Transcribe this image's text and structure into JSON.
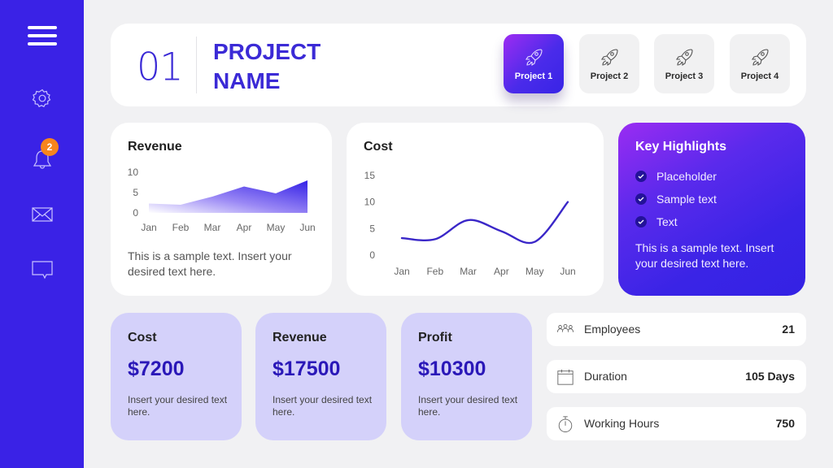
{
  "sidebar": {
    "items": [
      {
        "icon": "menu-icon"
      },
      {
        "icon": "gear-icon"
      },
      {
        "icon": "bell-icon",
        "badge": "2"
      },
      {
        "icon": "mail-icon"
      },
      {
        "icon": "chat-icon"
      }
    ],
    "notification_count": "2"
  },
  "header": {
    "project_number": "01",
    "project_name_line1": "PROJECT",
    "project_name_line2": "NAME",
    "tabs": [
      {
        "label": "Project 1",
        "icon": "rocket-icon",
        "active": true
      },
      {
        "label": "Project 2",
        "icon": "rocket-icon",
        "active": false
      },
      {
        "label": "Project 3",
        "icon": "rocket-icon",
        "active": false
      },
      {
        "label": "Project 4",
        "icon": "rocket-icon",
        "active": false
      }
    ]
  },
  "revenue_card": {
    "title": "Revenue",
    "description": "This is a sample text. Insert your desired text here."
  },
  "cost_card": {
    "title": "Cost"
  },
  "chart_data": [
    {
      "type": "area",
      "title": "Revenue",
      "categories": [
        "Jan",
        "Feb",
        "Mar",
        "Apr",
        "May",
        "Jun"
      ],
      "values": [
        2.3,
        2,
        4,
        6.5,
        4.8,
        8
      ],
      "yticks": [
        0,
        5,
        10
      ],
      "ylim": [
        0,
        10
      ],
      "xlabel": "",
      "ylabel": "",
      "grid": false,
      "gradient": [
        "#ffffff",
        "#3a24e6"
      ]
    },
    {
      "type": "line",
      "title": "Cost",
      "categories": [
        "Jan",
        "Feb",
        "Mar",
        "Apr",
        "May",
        "Jun"
      ],
      "values": [
        3.2,
        3,
        6.6,
        4.5,
        2.5,
        10
      ],
      "yticks": [
        0,
        5,
        10,
        15
      ],
      "ylim": [
        0,
        15
      ],
      "xlabel": "",
      "ylabel": "",
      "grid": false,
      "line_color": "#3a27c8",
      "smooth": true
    }
  ],
  "highlights": {
    "title": "Key Highlights",
    "items": [
      "Placeholder",
      "Sample text",
      "Text"
    ],
    "description": "This is a sample text. Insert your desired text here."
  },
  "stats": [
    {
      "label": "Cost",
      "value": "$7200",
      "description": "Insert your desired text here."
    },
    {
      "label": "Revenue",
      "value": "$17500",
      "description": "Insert your desired text here."
    },
    {
      "label": "Profit",
      "value": "$10300",
      "description": "Insert your desired text here."
    }
  ],
  "info": [
    {
      "icon": "people-icon",
      "label": "Employees",
      "value": "21"
    },
    {
      "icon": "calendar-icon",
      "label": "Duration",
      "value": "105 Days"
    },
    {
      "icon": "stopwatch-icon",
      "label": "Working Hours",
      "value": "750"
    }
  ],
  "colors": {
    "brand": "#3a22e6",
    "accent_text": "#3b2ad6",
    "badge": "#f7851d",
    "stat_bg": "#d4d1fa",
    "stat_value": "#2a18b8"
  }
}
